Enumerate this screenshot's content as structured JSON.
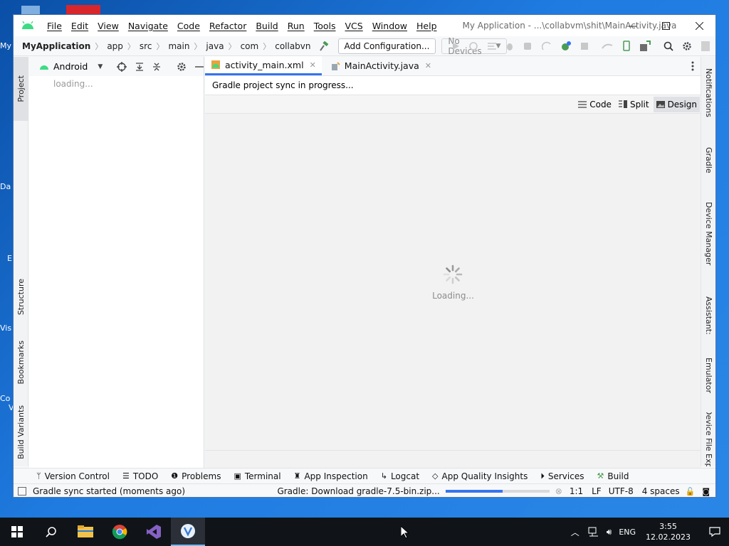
{
  "desktop": {
    "icon_labels": [
      "My",
      "Da",
      "E",
      "Vis",
      "Co",
      "V"
    ]
  },
  "window": {
    "menu": [
      "File",
      "Edit",
      "View",
      "Navigate",
      "Code",
      "Refactor",
      "Build",
      "Run",
      "Tools",
      "VCS",
      "Window",
      "Help"
    ],
    "title": "My Application - ...\\collabvm\\shit\\MainActivity.java"
  },
  "navbar": {
    "project": "MyApplication",
    "breadcrumbs": [
      "app",
      "src",
      "main",
      "java",
      "com",
      "collabvn"
    ],
    "run_config": "Add Configuration...",
    "device": "No Devices"
  },
  "left_tabs": {
    "project": "Project",
    "structure": "Structure",
    "bookmarks": "Bookmarks",
    "build_variants": "Build Variants"
  },
  "right_tabs": [
    "Notifications",
    "Gradle",
    "Device Manager",
    "Assistant:",
    "Emulator",
    "Device File Expl"
  ],
  "project_panel": {
    "view": "Android",
    "loading": "loading..."
  },
  "editor": {
    "tabs": [
      {
        "label": "activity_main.xml",
        "active": true
      },
      {
        "label": "MainActivity.java",
        "active": false
      }
    ],
    "notice": "Gradle project sync in progress...",
    "view_modes": [
      "Code",
      "Split",
      "Design"
    ],
    "selected_mode": "Design",
    "loading": "Loading..."
  },
  "bottom_tools": [
    "Version Control",
    "TODO",
    "Problems",
    "Terminal",
    "App Inspection",
    "Logcat",
    "App Quality Insights",
    "Services",
    "Build"
  ],
  "statusbar": {
    "message": "Gradle sync started (moments ago)",
    "task": "Gradle: Download gradle-7.5-bin.zip...",
    "progress": 0.55,
    "position": "1:1",
    "line_sep": "LF",
    "encoding": "UTF-8",
    "indent": "4 spaces"
  },
  "taskbar": {
    "lang": "ENG",
    "time": "3:55",
    "date": "12.02.2023"
  },
  "colors": {
    "accent": "#3574f0",
    "android_green": "#3ddc84",
    "desktop": "#1f7be0",
    "taskbar": "#101418"
  }
}
